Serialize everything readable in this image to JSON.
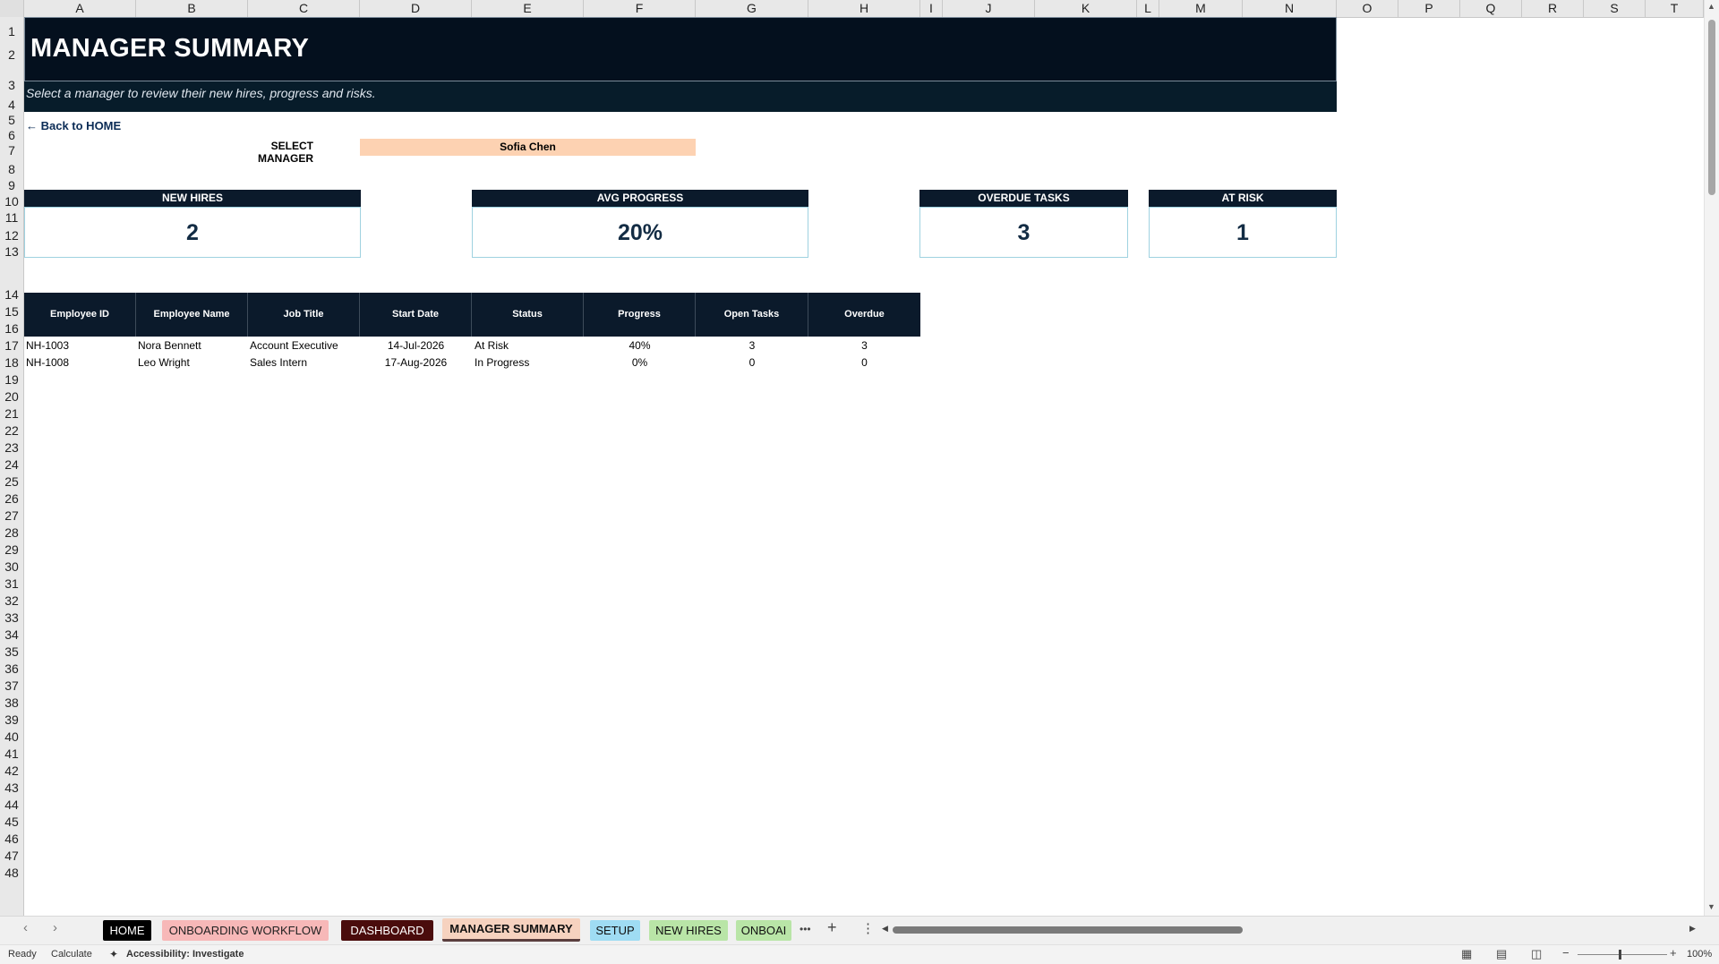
{
  "columns": [
    "A",
    "B",
    "C",
    "D",
    "E",
    "F",
    "G",
    "H",
    "I",
    "J",
    "K",
    "L",
    "M",
    "N",
    "O",
    "P",
    "Q",
    "R",
    "S",
    "T"
  ],
  "rows": [
    "1",
    "2",
    "3",
    "4",
    "5",
    "6",
    "7",
    "8",
    "9",
    "10",
    "11",
    "12",
    "13",
    "14",
    "15",
    "16",
    "17",
    "18",
    "19",
    "20",
    "21",
    "22",
    "23",
    "24",
    "25",
    "26",
    "27",
    "28",
    "29",
    "30",
    "31",
    "32",
    "33",
    "34",
    "35",
    "36",
    "37",
    "38",
    "39",
    "40",
    "41",
    "42",
    "43",
    "44",
    "45",
    "46",
    "47",
    "48"
  ],
  "sheet": {
    "title": "MANAGER SUMMARY",
    "subtitle": "Select a manager to review their new hires, progress and risks.",
    "back_link": "← Back to HOME",
    "select_label": "SELECT MANAGER",
    "select_value": "Sofia Chen"
  },
  "kpis": [
    {
      "label": "NEW HIRES",
      "value": "2"
    },
    {
      "label": "AVG PROGRESS",
      "value": "20%"
    },
    {
      "label": "OVERDUE TASKS",
      "value": "3"
    },
    {
      "label": "AT RISK",
      "value": "1"
    }
  ],
  "table": {
    "headers": [
      "Employee ID",
      "Employee Name",
      "Job Title",
      "Start Date",
      "Status",
      "Progress",
      "Open Tasks",
      "Overdue"
    ],
    "rows": [
      [
        "NH-1003",
        "Nora Bennett",
        "Account Executive",
        "14-Jul-2026",
        "At Risk",
        "40%",
        "3",
        "3"
      ],
      [
        "NH-1008",
        "Leo Wright",
        "Sales Intern",
        "17-Aug-2026",
        "In Progress",
        "0%",
        "0",
        "0"
      ]
    ]
  },
  "tabs": [
    {
      "label": "HOME",
      "bg": "#000000",
      "fg": "#ffffff"
    },
    {
      "label": "ONBOARDING WORKFLOW",
      "bg": "#f7b8b8",
      "fg": "#222222"
    },
    {
      "label": "DASHBOARD",
      "bg": "#4a0c0c",
      "fg": "#ffffff"
    },
    {
      "label": "MANAGER SUMMARY",
      "bg": "#f6d2bf",
      "fg": "#111111"
    },
    {
      "label": "SETUP",
      "bg": "#9fdcf3",
      "fg": "#111111"
    },
    {
      "label": "NEW HIRES",
      "bg": "#b9e5a7",
      "fg": "#111111"
    },
    {
      "label": "ONBOAI",
      "bg": "#b9e5a7",
      "fg": "#111111"
    }
  ],
  "tab_overflow": "•••",
  "status": {
    "ready": "Ready",
    "calculate": "Calculate",
    "accessibility": "Accessibility: Investigate",
    "zoom": "100%"
  }
}
